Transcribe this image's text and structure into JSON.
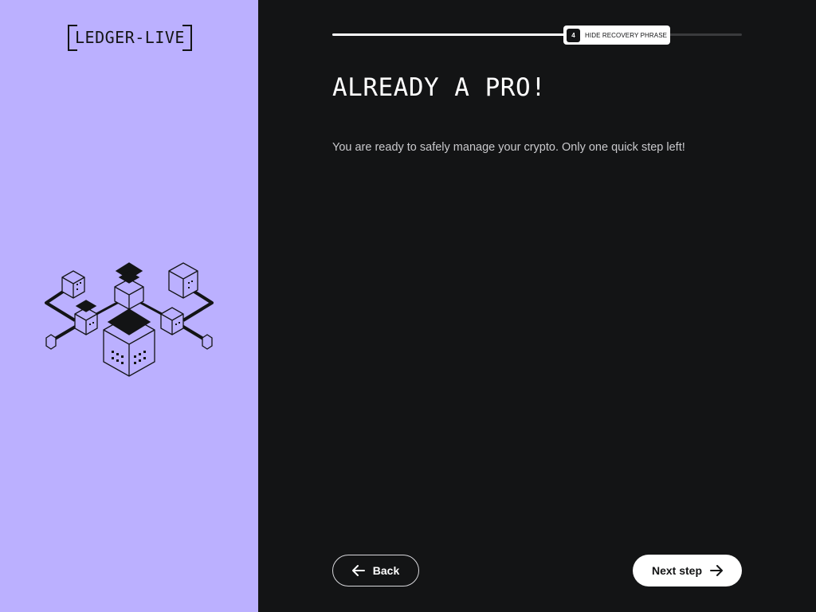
{
  "brand": {
    "logo_text": "LEDGER-LIVE"
  },
  "progress": {
    "step_number": "4",
    "step_label": "HIDE RECOVERY PHRASE",
    "fill_fraction": 0.57
  },
  "main": {
    "title": "ALREADY A PRO!",
    "subtitle": "You are ready to safely manage your crypto. Only one quick step left!"
  },
  "footer": {
    "back_label": "Back",
    "next_label": "Next step"
  },
  "colors": {
    "left_panel": "#bbb0ff",
    "background": "#131415",
    "text_primary": "#ffffff",
    "text_secondary": "#c9c9cc"
  },
  "icons": {
    "back": "arrow-left-icon",
    "next": "arrow-right-icon"
  }
}
